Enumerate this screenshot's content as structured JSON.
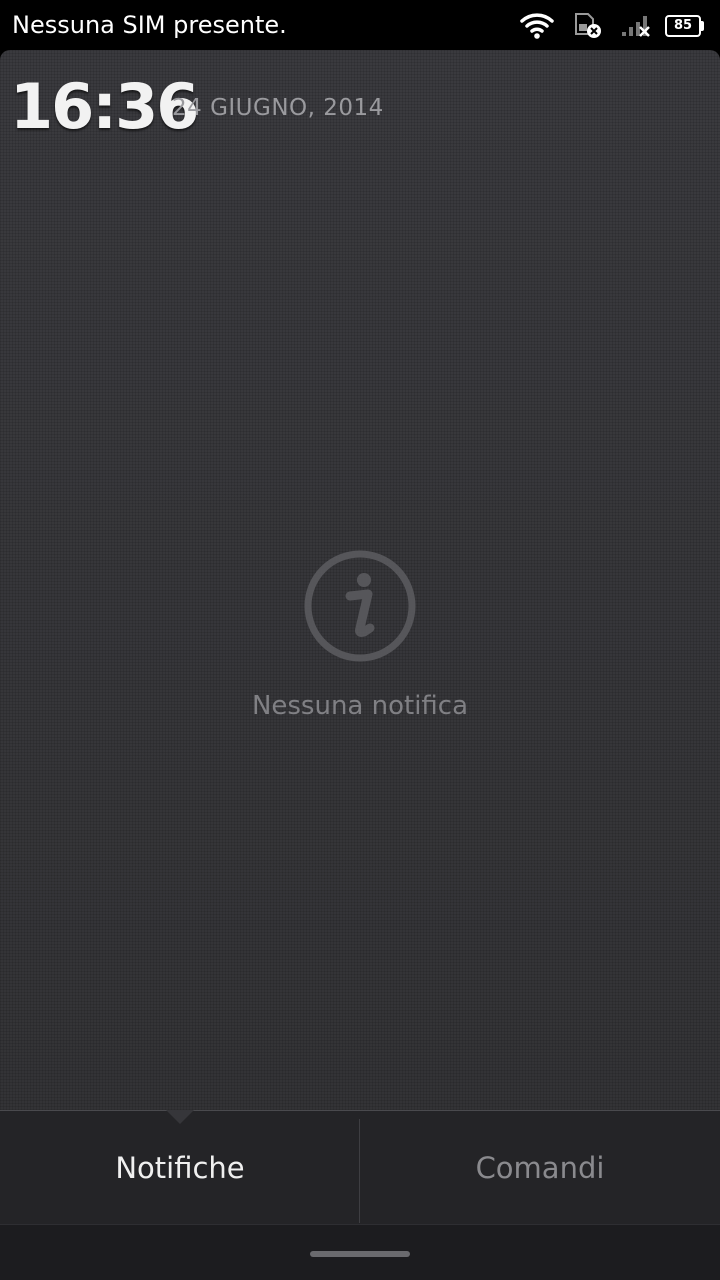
{
  "status_bar": {
    "carrier_text": "Nessuna SIM presente.",
    "battery_level": "85",
    "icons": [
      "wifi-icon",
      "sim-card-missing-icon",
      "signal-no-service-icon",
      "battery-icon"
    ]
  },
  "header": {
    "time": "16:36",
    "date": "24 GIUGNO, 2014"
  },
  "notifications": {
    "empty_icon": "info-icon",
    "empty_text": "Nessuna notifica"
  },
  "tabs": [
    {
      "label": "Notifiche",
      "selected": true
    },
    {
      "label": "Comandi",
      "selected": false
    }
  ],
  "colors": {
    "shade_background": "#36363a",
    "tab_selected_text": "#f0f0f0",
    "tab_unselected_text": "#8a8a8e"
  }
}
